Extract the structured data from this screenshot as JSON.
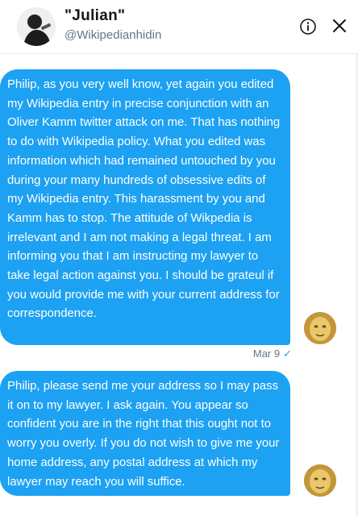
{
  "header": {
    "display_name": "\"Julian\"",
    "handle": "@Wikipedianhidin",
    "avatar_icon": "user-avatar-icon",
    "info_icon": "info-icon",
    "close_icon": "close-icon"
  },
  "messages": [
    {
      "text": "Philip, as you very well know, yet again you edited my Wikipedia entry in precise conjunction with an Oliver Kamm twitter attack on me. That has nothing to do with Wikipedia policy. What you edited was information which had remained untouched by you during your many hundreds of obsessive edits of my Wikipedia entry. This harassment by you and Kamm has to stop. The attitude of Wikpedia is irrelevant and I am not making a legal threat. I am informing you that I am instructing my lawyer to take legal action against you. I should be grateul if you would provide me with your current address for correspondence.",
      "timestamp": "Mar 9",
      "status_icon": "checkmark-icon"
    },
    {
      "text": "Philip, please send me your address so I may pass it on to my lawyer. I ask again. You appear so confident you are in the right that this ought not to worry you overly. If you do not wish to give me your home address, any postal address at which my lawyer may reach you will suffice."
    }
  ],
  "colors": {
    "bubble": "#1da1f2",
    "bubble_text": "#ffffff",
    "name": "#14171a",
    "secondary": "#657786"
  }
}
